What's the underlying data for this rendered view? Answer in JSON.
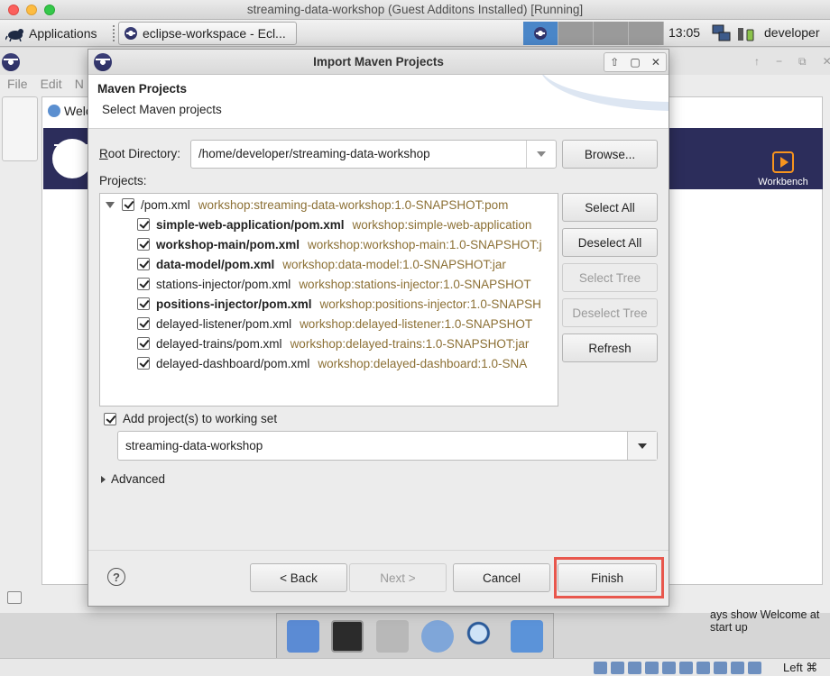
{
  "host": {
    "title": "streaming-data-workshop (Guest Additons Installed) [Running]",
    "host_key": "Left ⌘"
  },
  "guest_panel": {
    "applications": "Applications",
    "task_label": "eclipse-workspace - Ecl...",
    "clock": "13:05",
    "user": "developer"
  },
  "eclipse": {
    "menu": [
      "File",
      "Edit",
      "N"
    ],
    "welcome_tab": "Welc",
    "workbench_label": "Workbench",
    "always_show": "ays show Welcome at start up"
  },
  "dialog": {
    "title": "Import Maven Projects",
    "header_title": "Maven Projects",
    "header_subtitle": "Select Maven projects",
    "root_label": "Root Directory:",
    "root_value": "/home/developer/streaming-data-workshop",
    "browse": "Browse...",
    "projects_label": "Projects:",
    "tree": {
      "root": {
        "name": "/pom.xml",
        "gav": "workshop:streaming-data-workshop:1.0-SNAPSHOT:pom"
      },
      "children": [
        {
          "name": "simple-web-application/pom.xml",
          "gav": "workshop:simple-web-application",
          "bold": true
        },
        {
          "name": "workshop-main/pom.xml",
          "gav": "workshop:workshop-main:1.0-SNAPSHOT:j",
          "bold": true
        },
        {
          "name": "data-model/pom.xml",
          "gav": "workshop:data-model:1.0-SNAPSHOT:jar",
          "bold": true
        },
        {
          "name": "stations-injector/pom.xml",
          "gav": "workshop:stations-injector:1.0-SNAPSHOT",
          "bold": false
        },
        {
          "name": "positions-injector/pom.xml",
          "gav": "workshop:positions-injector:1.0-SNAPSH",
          "bold": true
        },
        {
          "name": "delayed-listener/pom.xml",
          "gav": "workshop:delayed-listener:1.0-SNAPSHOT",
          "bold": false
        },
        {
          "name": "delayed-trains/pom.xml",
          "gav": "workshop:delayed-trains:1.0-SNAPSHOT:jar",
          "bold": false
        },
        {
          "name": "delayed-dashboard/pom.xml",
          "gav": "workshop:delayed-dashboard:1.0-SNA",
          "bold": false
        }
      ]
    },
    "side_buttons": {
      "select_all": "Select All",
      "deselect_all": "Deselect All",
      "select_tree": "Select Tree",
      "deselect_tree": "Deselect Tree",
      "refresh": "Refresh"
    },
    "working_set_label": "Add project(s) to working set",
    "working_set_value": "streaming-data-workshop",
    "advanced": "Advanced",
    "footer": {
      "help": "?",
      "back": "< Back",
      "next": "Next >",
      "cancel": "Cancel",
      "finish": "Finish"
    },
    "highlight_color": "#e8574d"
  }
}
